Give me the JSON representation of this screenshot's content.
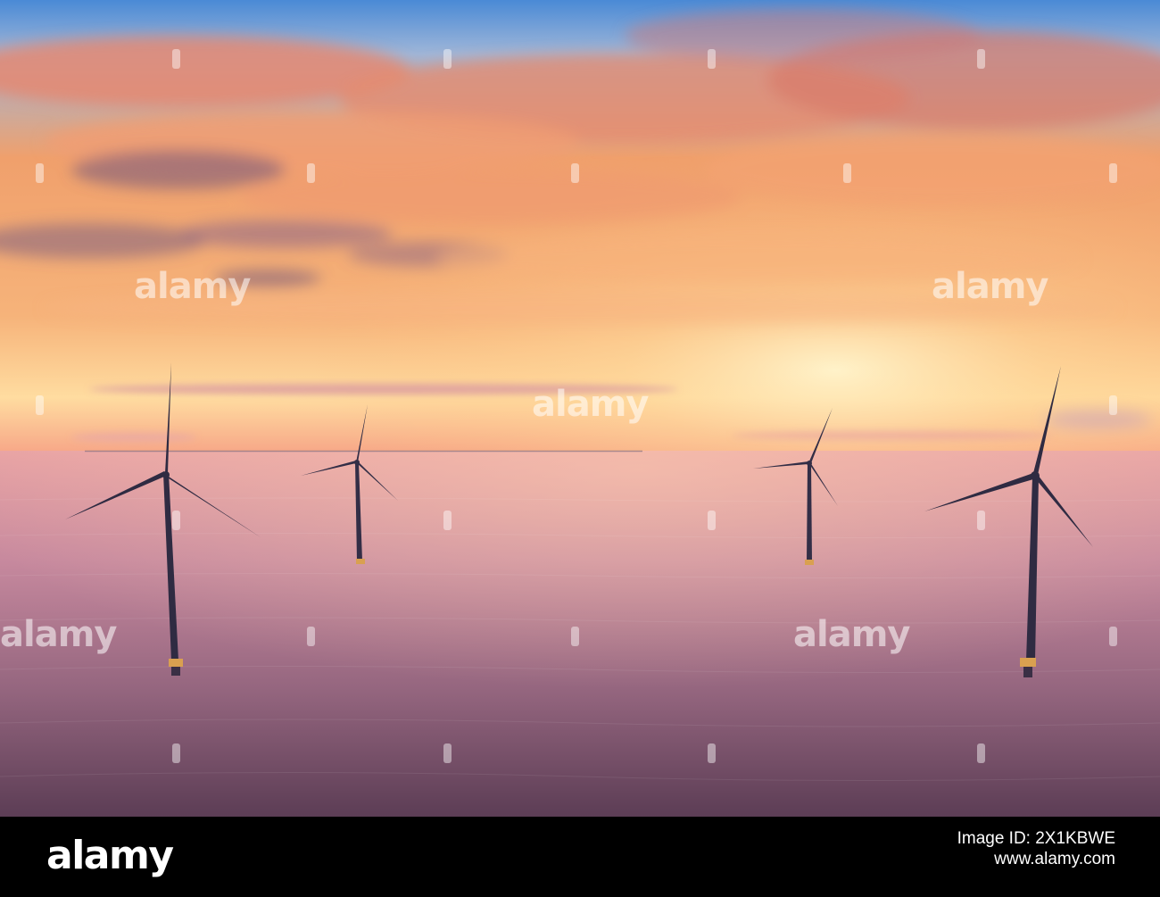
{
  "photo": {
    "subject": "offshore wind turbines at sunset",
    "colors": {
      "sky_top": "#3f86d6",
      "sky_mid": "#f2a06a",
      "horizon_glow": "#ffe2a0",
      "sea": "#b07a9a",
      "sea_dark": "#5f3f58",
      "turbine": "#2e2a40"
    },
    "watermark_text": "alamy"
  },
  "footer": {
    "logo_text": "alamy",
    "image_id": "Image ID: 2X1KBWE",
    "url": "www.alamy.com"
  }
}
